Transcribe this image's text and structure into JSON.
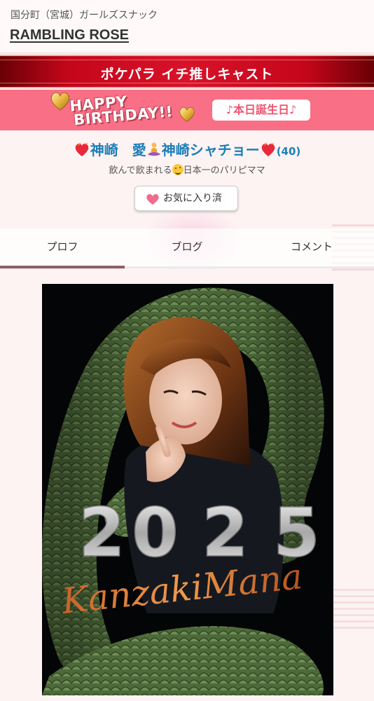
{
  "header": {
    "location": "国分町（宮城）ガールズスナック",
    "shop_name": "RAMBLING ROSE"
  },
  "banner": {
    "title": "ポケパラ イチ推しキャスト"
  },
  "birthday": {
    "line1": "HAPPY",
    "line2": "BIRTHDAY!!",
    "today_label": "♪本日誕生日♪"
  },
  "profile": {
    "name_part1": "神崎　愛",
    "name_part2": "神崎シャチョー",
    "age": "(40)",
    "catch_before": "飲んで飲まれる",
    "catch_after": "日本一のパリピママ",
    "favorite_label": "お気に入り済"
  },
  "tabs": [
    {
      "label": "プロフ",
      "active": true
    },
    {
      "label": "ブログ",
      "active": false
    },
    {
      "label": "コメント",
      "active": false
    }
  ],
  "photo": {
    "year_text": "2025",
    "signature": "KanzakiMana"
  },
  "colors": {
    "banner_red": "#d8122a",
    "birthday_pink": "#f96f86",
    "name_blue": "#1d7fb8",
    "tab_active": "#8c5f63"
  },
  "icons": [
    "gold-heart-icon",
    "burning-heart-icon",
    "meditation-icon",
    "grinning-face-icon",
    "pink-heart-icon"
  ]
}
